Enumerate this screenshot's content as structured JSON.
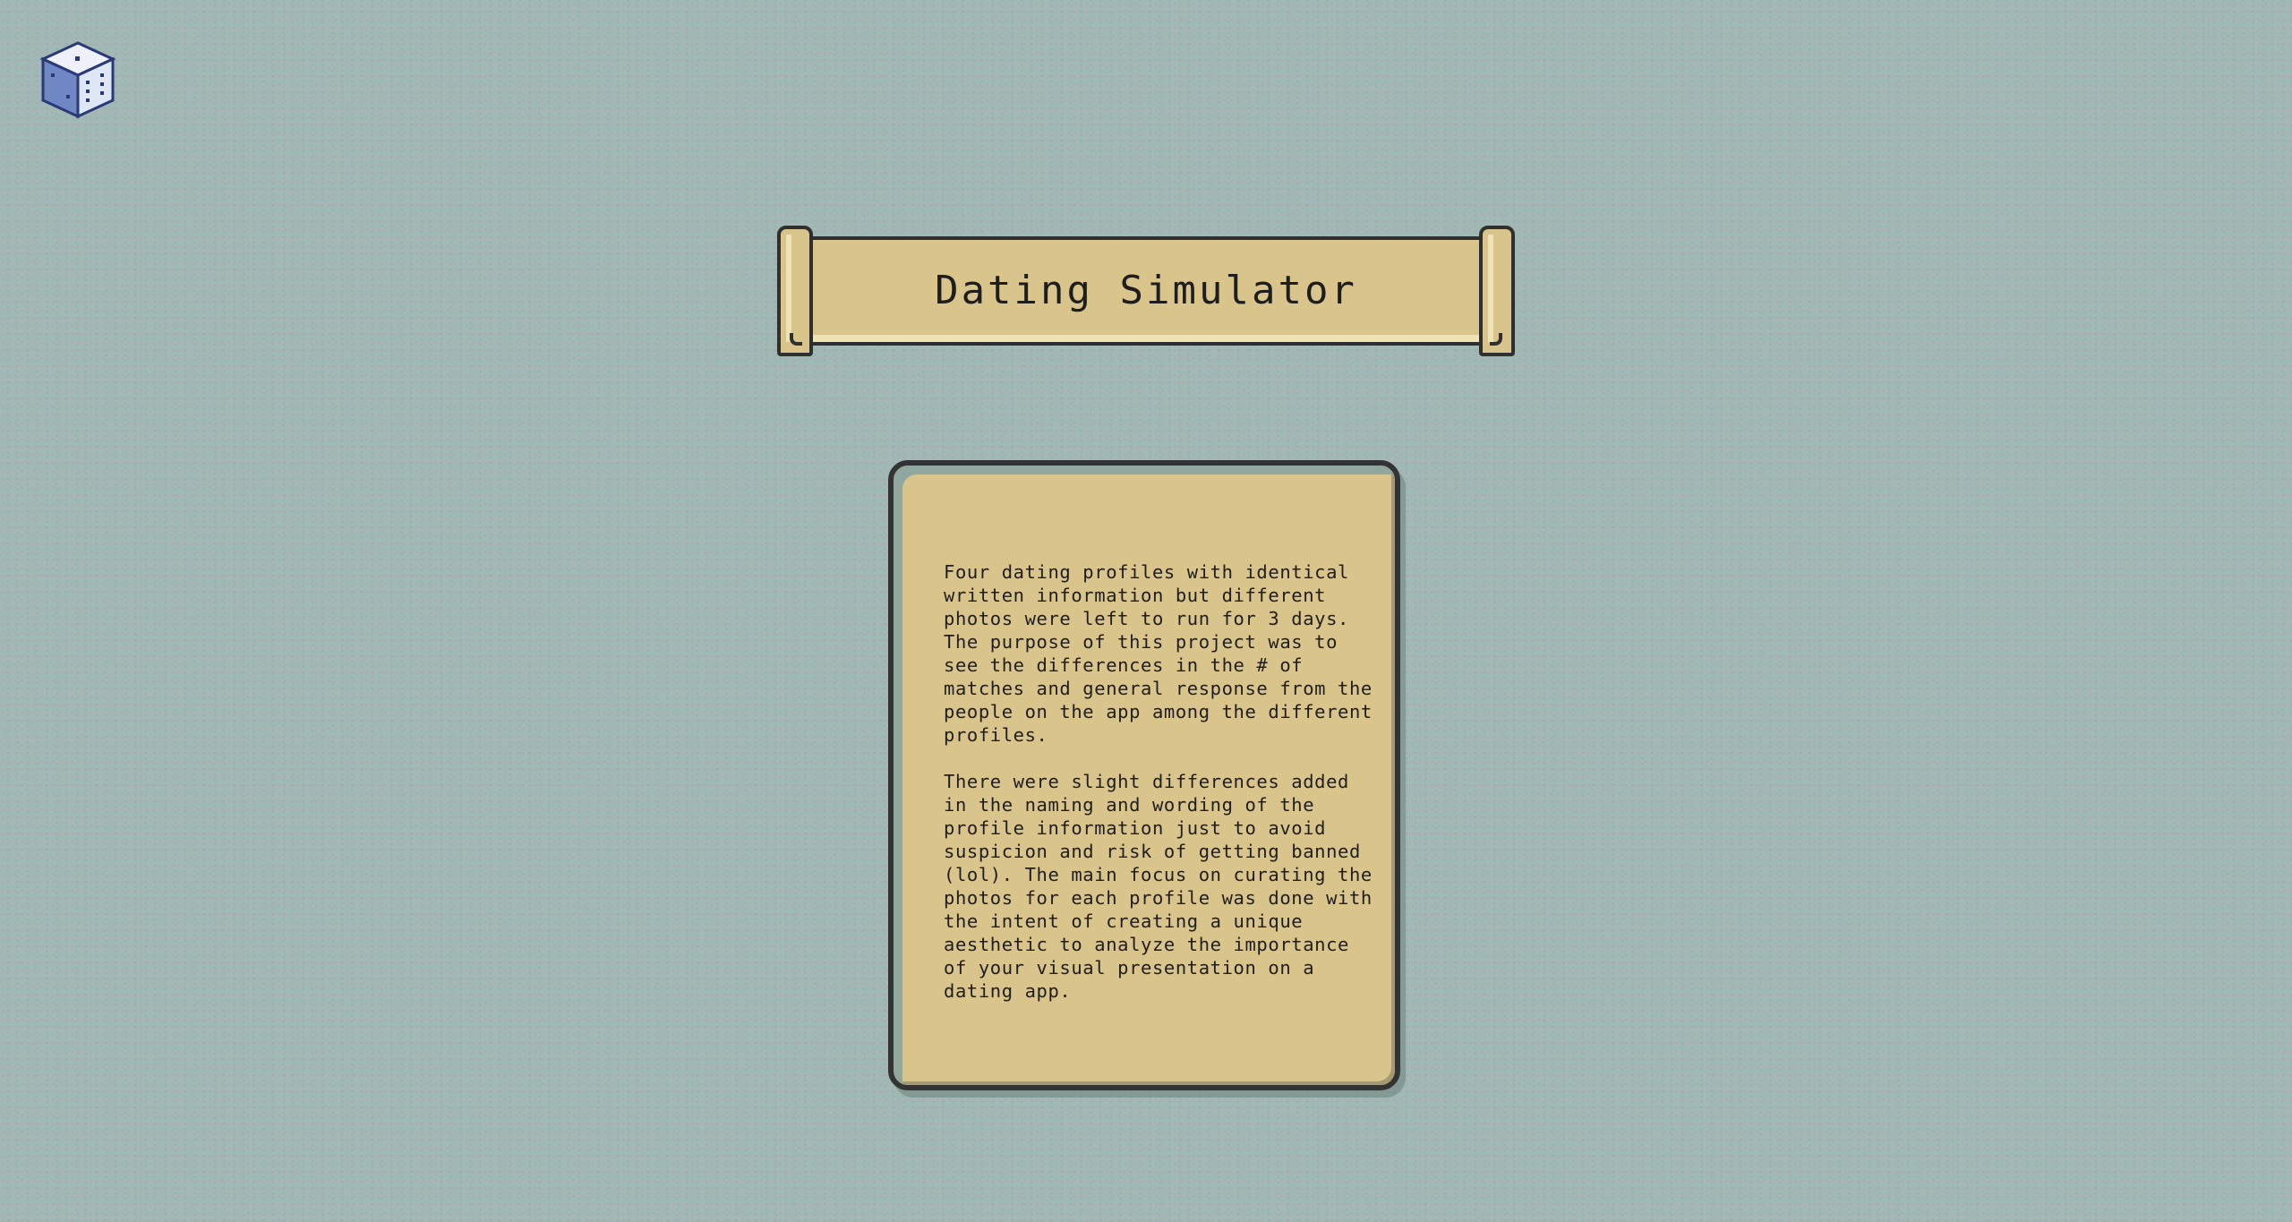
{
  "logo": {
    "icon": "dice-icon",
    "colors": {
      "top": "#eef1fb",
      "left": "#6f88c4",
      "right": "#dfe6f6",
      "outline": "#2a3a78"
    }
  },
  "header": {
    "title": "Dating Simulator"
  },
  "card": {
    "paragraphs": [
      "Four dating profiles with identical written information but different photos were left to run for 3 days. The purpose of this project was to see the differences in the # of matches and general response from the people on the app among the different profiles.",
      "There were slight differences added in the naming and wording of the profile information just to avoid suspicion and risk of getting banned (lol). The main focus on curating the photos for each profile was done with the intent of creating a unique aesthetic to analyze the importance of your visual presentation on a dating app."
    ]
  },
  "colors": {
    "background": "#9fbab6",
    "parchment": "#d9c48b",
    "outline": "#2f2f2f"
  }
}
